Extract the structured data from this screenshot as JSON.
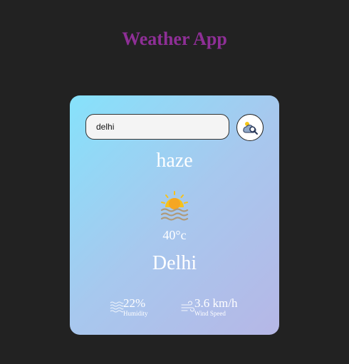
{
  "app": {
    "title": "Weather App"
  },
  "search": {
    "value": "delhi",
    "placeholder": ""
  },
  "weather": {
    "condition": "haze",
    "temperature": "40°c",
    "city": "Delhi",
    "icon": "haze-sun-icon"
  },
  "stats": {
    "humidity": {
      "value": "22%",
      "label": "Humidity",
      "icon": "humidity-icon"
    },
    "wind": {
      "value": "3.6 km/h",
      "label": "Wind Speed",
      "icon": "wind-icon"
    }
  },
  "colors": {
    "background": "#222222",
    "title": "#8e2f96",
    "card_gradient_start": "#86e2fb",
    "card_gradient_end": "#b6b7e6",
    "text": "#ffffff",
    "sun": "#f7c21a"
  }
}
